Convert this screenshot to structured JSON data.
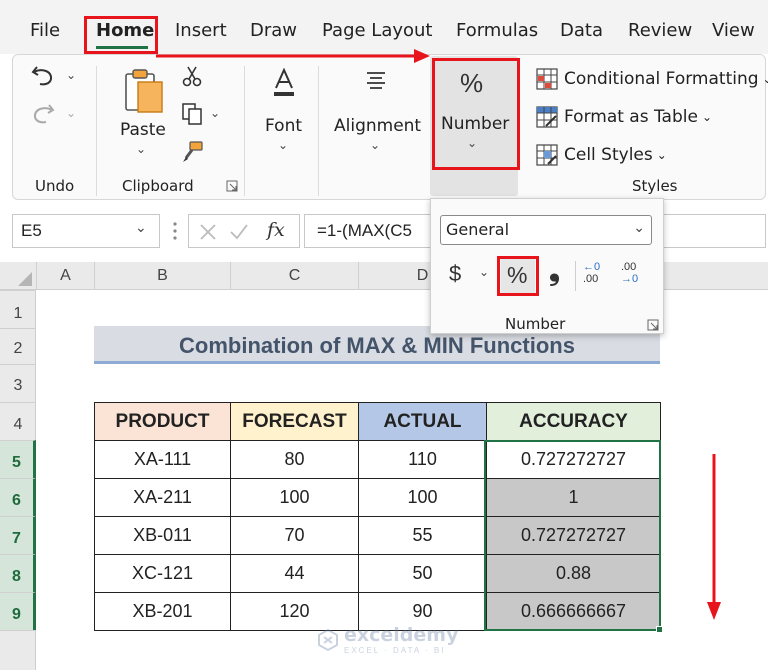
{
  "menu": {
    "tabs": [
      "File",
      "Home",
      "Insert",
      "Draw",
      "Page Layout",
      "Formulas",
      "Data",
      "Review",
      "View"
    ]
  },
  "ribbon": {
    "undo_group": "Undo",
    "clipboard": {
      "paste": "Paste",
      "group": "Clipboard"
    },
    "font": "Font",
    "alignment": "Alignment",
    "number": {
      "label": "Number",
      "icon": "%"
    },
    "styles": {
      "conditional": "Conditional Formatting",
      "format_table": "Format as Table",
      "cell_styles": "Cell Styles",
      "group": "Styles"
    }
  },
  "formula_bar": {
    "name_box": "E5",
    "fx": "fx",
    "formula": "=1-(MAX(C5"
  },
  "number_dropdown": {
    "format": "General",
    "currency": "$",
    "percent": "%",
    "comma": "❟",
    "increase_decimal_top": "←0",
    "increase_decimal_bottom": ".00",
    "decrease_decimal_top": ".00",
    "decrease_decimal_bottom": "→0",
    "group": "Number"
  },
  "grid": {
    "columns": [
      "A",
      "B",
      "C",
      "D"
    ],
    "rows": [
      "1",
      "2",
      "3",
      "4",
      "5",
      "6",
      "7",
      "8",
      "9"
    ]
  },
  "sheet": {
    "title": "Combination of MAX & MIN Functions",
    "headers": [
      "PRODUCT",
      "FORECAST",
      "ACTUAL",
      "ACCURACY"
    ],
    "rows": [
      [
        "XA-111",
        "80",
        "110",
        "0.727272727"
      ],
      [
        "XA-211",
        "100",
        "100",
        "1"
      ],
      [
        "XB-011",
        "70",
        "55",
        "0.727272727"
      ],
      [
        "XC-121",
        "44",
        "50",
        "0.88"
      ],
      [
        "XB-201",
        "120",
        "90",
        "0.666666667"
      ]
    ]
  },
  "colors": {
    "header_product": "#fbe3d5",
    "header_forecast": "#fff2cc",
    "header_actual": "#b4c7e7",
    "header_accuracy": "#e2efda",
    "selected_fill": "#c8c8c8",
    "annotation_red": "#e8141b"
  },
  "watermark": {
    "name": "exceldemy",
    "tag": "EXCEL · DATA · BI"
  }
}
